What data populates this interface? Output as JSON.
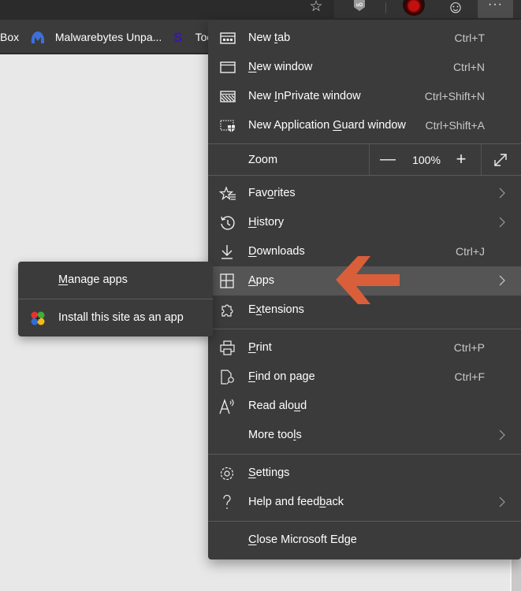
{
  "toolbar": {
    "icons": [
      "favorites-add-icon",
      "ublock-origin-icon",
      "profile-avatar",
      "feedback-smiley-icon",
      "settings-more-icon"
    ],
    "more_label": "···"
  },
  "bookmarks": [
    {
      "label": "Box",
      "icon": null
    },
    {
      "label": "Malwarebytes Unpa...",
      "icon": "malwarebytes-icon"
    },
    {
      "label": "Toc",
      "icon": "s-icon"
    }
  ],
  "menu": {
    "items": [
      {
        "label_pre": "New ",
        "label_u": "t",
        "label_post": "ab",
        "shortcut": "Ctrl+T",
        "icon": "new-tab-icon"
      },
      {
        "label_pre": "",
        "label_u": "N",
        "label_post": "ew window",
        "shortcut": "Ctrl+N",
        "icon": "new-window-icon"
      },
      {
        "label_pre": "New ",
        "label_u": "I",
        "label_post": "nPrivate window",
        "shortcut": "Ctrl+Shift+N",
        "icon": "inprivate-icon"
      },
      {
        "label_pre": "New Application ",
        "label_u": "G",
        "label_post": "uard window",
        "shortcut": "Ctrl+Shift+A",
        "icon": "application-guard-icon"
      }
    ],
    "zoom": {
      "label": "Zoom",
      "minus": "—",
      "value": "100%",
      "plus": "+"
    },
    "items2": [
      {
        "label_pre": "Fav",
        "label_u": "o",
        "label_post": "rites",
        "shortcut": "",
        "submenu": true,
        "icon": "favorites-icon"
      },
      {
        "label_pre": "",
        "label_u": "H",
        "label_post": "istory",
        "shortcut": "",
        "submenu": true,
        "icon": "history-icon"
      },
      {
        "label_pre": "",
        "label_u": "D",
        "label_post": "ownloads",
        "shortcut": "Ctrl+J",
        "submenu": false,
        "icon": "downloads-icon"
      },
      {
        "label_pre": "",
        "label_u": "A",
        "label_post": "pps",
        "shortcut": "",
        "submenu": true,
        "icon": "apps-icon",
        "active": true
      },
      {
        "label_pre": "E",
        "label_u": "x",
        "label_post": "tensions",
        "shortcut": "",
        "submenu": false,
        "icon": "extensions-icon"
      }
    ],
    "items3": [
      {
        "label_pre": "",
        "label_u": "P",
        "label_post": "rint",
        "shortcut": "Ctrl+P",
        "submenu": false,
        "icon": "print-icon"
      },
      {
        "label_pre": "",
        "label_u": "F",
        "label_post": "ind on page",
        "shortcut": "Ctrl+F",
        "submenu": false,
        "icon": "find-on-page-icon"
      },
      {
        "label_pre": "Read alo",
        "label_u": "u",
        "label_post": "d",
        "shortcut": "",
        "submenu": false,
        "icon": "read-aloud-icon"
      },
      {
        "label_pre": "More too",
        "label_u": "l",
        "label_post": "s",
        "shortcut": "",
        "submenu": true,
        "icon": null
      }
    ],
    "items4": [
      {
        "label_pre": "",
        "label_u": "S",
        "label_post": "ettings",
        "shortcut": "",
        "submenu": false,
        "icon": "settings-icon"
      },
      {
        "label_pre": "Help and feed",
        "label_u": "b",
        "label_post": "ack",
        "shortcut": "",
        "submenu": true,
        "icon": "help-icon"
      }
    ],
    "close": {
      "label_pre": "",
      "label_u": "C",
      "label_post": "lose Microsoft Edge"
    }
  },
  "submenu": {
    "items": [
      {
        "label_pre": "",
        "label_u": "M",
        "label_post": "anage apps",
        "icon": null
      },
      {
        "label_pre": "Install this site as an app",
        "label_u": "",
        "label_post": "",
        "icon": "install-app-icon"
      }
    ]
  },
  "annotation": {
    "arrow_color": "#d95f3b"
  },
  "colors": {
    "menu_bg": "#3b3b3b",
    "active_bg": "#555555",
    "page_bg": "#e8e8e8"
  }
}
